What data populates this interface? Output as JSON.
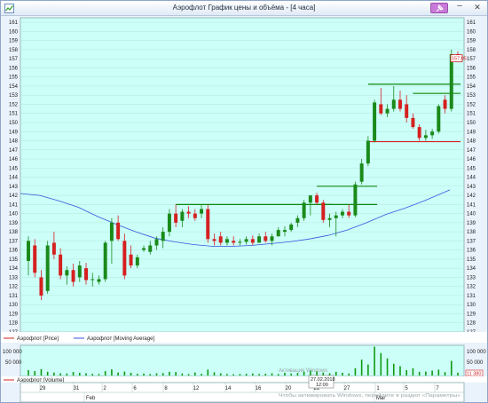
{
  "window": {
    "title": "Аэрофлот График цены и объёма - [4 часа]",
    "min_glyph": "–",
    "close_glyph": "✕"
  },
  "legend": {
    "price_label": "Аэрофлот [Price]",
    "ma_label": "Аэрофлот [Moving Average]",
    "volume_label": "Аэрофлот [Volume]"
  },
  "colors": {
    "chart_bg": "#ccfff8",
    "up": "#1a8a1a",
    "down": "#d62020",
    "ma_line": "#3355dd",
    "level_green": "#118811",
    "level_red": "#dd2222",
    "volume_bar": "#119911"
  },
  "price_axis": {
    "ticks": [
      "127",
      "128",
      "129",
      "130",
      "131",
      "132",
      "133",
      "134",
      "135",
      "136",
      "137",
      "138",
      "139",
      "140",
      "141",
      "142",
      "143",
      "144",
      "145",
      "146",
      "147",
      "148",
      "149",
      "150",
      "151",
      "152",
      "153",
      "154",
      "155",
      "156",
      "157",
      "158",
      "159",
      "160",
      "161"
    ],
    "last_price": "157.05"
  },
  "volume_axis": {
    "ticks": [
      "100 000",
      "50 000"
    ],
    "last_volume": "11 380"
  },
  "time_axis": {
    "day_labels": [
      "29",
      "31",
      "2",
      "6",
      "8",
      "12",
      "14",
      "16",
      "20",
      "22",
      "27",
      "1",
      "5",
      "7"
    ],
    "month_labels": [
      "Feb",
      "Mar"
    ],
    "cursor_date": "27.02.2018",
    "cursor_time": "12:00"
  },
  "watermark": {
    "line1": "Активация Windows",
    "line2": "Чтобы активировать Windows, перейдите в раздел «Параметры»"
  },
  "chart_data": {
    "type": "candlestick",
    "timeframe": "4 часа",
    "ylim": [
      127,
      161.5
    ],
    "candles": [
      {
        "o": 134.8,
        "h": 137.5,
        "l": 133.2,
        "c": 137.0
      },
      {
        "o": 136.5,
        "h": 137.2,
        "l": 133.0,
        "c": 133.5
      },
      {
        "o": 133.0,
        "h": 133.8,
        "l": 130.5,
        "c": 131.0
      },
      {
        "o": 131.5,
        "h": 137.0,
        "l": 131.2,
        "c": 136.5
      },
      {
        "o": 136.8,
        "h": 138.0,
        "l": 135.0,
        "c": 135.5
      },
      {
        "o": 135.5,
        "h": 136.2,
        "l": 132.8,
        "c": 133.2
      },
      {
        "o": 133.2,
        "h": 134.2,
        "l": 132.2,
        "c": 133.8
      },
      {
        "o": 133.8,
        "h": 134.5,
        "l": 132.0,
        "c": 132.5
      },
      {
        "o": 133.0,
        "h": 134.8,
        "l": 132.5,
        "c": 134.3
      },
      {
        "o": 134.0,
        "h": 134.6,
        "l": 132.2,
        "c": 132.7
      },
      {
        "o": 132.7,
        "h": 133.5,
        "l": 132.0,
        "c": 132.8
      },
      {
        "o": 132.5,
        "h": 133.2,
        "l": 132.2,
        "c": 132.8
      },
      {
        "o": 132.8,
        "h": 137.0,
        "l": 132.5,
        "c": 136.8
      },
      {
        "o": 137.0,
        "h": 139.5,
        "l": 134.5,
        "c": 139.0
      },
      {
        "o": 139.0,
        "h": 139.8,
        "l": 137.0,
        "c": 137.2
      },
      {
        "o": 137.0,
        "h": 137.8,
        "l": 132.8,
        "c": 133.2
      },
      {
        "o": 135.5,
        "h": 136.5,
        "l": 134.0,
        "c": 134.3
      },
      {
        "o": 134.3,
        "h": 135.5,
        "l": 134.0,
        "c": 135.2
      },
      {
        "o": 136.0,
        "h": 136.5,
        "l": 135.8,
        "c": 136.2
      },
      {
        "o": 135.8,
        "h": 137.0,
        "l": 135.5,
        "c": 136.5
      },
      {
        "o": 136.5,
        "h": 137.5,
        "l": 136.0,
        "c": 137.2
      },
      {
        "o": 137.0,
        "h": 138.5,
        "l": 136.2,
        "c": 138.0
      },
      {
        "o": 138.0,
        "h": 140.5,
        "l": 137.5,
        "c": 140.0
      },
      {
        "o": 140.0,
        "h": 141.0,
        "l": 138.5,
        "c": 139.0
      },
      {
        "o": 139.2,
        "h": 140.5,
        "l": 138.5,
        "c": 140.2
      },
      {
        "o": 140.2,
        "h": 140.8,
        "l": 139.5,
        "c": 140.0
      },
      {
        "o": 140.0,
        "h": 140.5,
        "l": 139.2,
        "c": 139.5
      },
      {
        "o": 140.0,
        "h": 141.0,
        "l": 139.5,
        "c": 140.5
      },
      {
        "o": 140.5,
        "h": 141.0,
        "l": 136.8,
        "c": 137.2
      },
      {
        "o": 137.2,
        "h": 137.8,
        "l": 136.5,
        "c": 137.0
      },
      {
        "o": 137.5,
        "h": 138.0,
        "l": 136.5,
        "c": 136.8
      },
      {
        "o": 136.8,
        "h": 137.5,
        "l": 136.5,
        "c": 137.2
      },
      {
        "o": 137.0,
        "h": 137.5,
        "l": 136.5,
        "c": 136.8
      },
      {
        "o": 136.8,
        "h": 137.2,
        "l": 136.5,
        "c": 136.9
      },
      {
        "o": 136.9,
        "h": 137.5,
        "l": 136.6,
        "c": 137.2
      },
      {
        "o": 137.2,
        "h": 137.6,
        "l": 136.5,
        "c": 136.8
      },
      {
        "o": 136.8,
        "h": 137.8,
        "l": 136.8,
        "c": 137.5
      },
      {
        "o": 137.5,
        "h": 138.0,
        "l": 136.8,
        "c": 137.0
      },
      {
        "o": 137.0,
        "h": 137.8,
        "l": 136.5,
        "c": 137.5
      },
      {
        "o": 137.5,
        "h": 138.5,
        "l": 137.5,
        "c": 138.2
      },
      {
        "o": 138.0,
        "h": 138.6,
        "l": 137.5,
        "c": 138.2
      },
      {
        "o": 138.2,
        "h": 139.0,
        "l": 138.0,
        "c": 138.8
      },
      {
        "o": 139.0,
        "h": 139.8,
        "l": 138.5,
        "c": 139.5
      },
      {
        "o": 139.5,
        "h": 141.5,
        "l": 139.2,
        "c": 141.2
      },
      {
        "o": 141.2,
        "h": 142.0,
        "l": 139.8,
        "c": 142.0
      },
      {
        "o": 142.0,
        "h": 142.3,
        "l": 141.0,
        "c": 141.2
      },
      {
        "o": 141.2,
        "h": 141.5,
        "l": 139.0,
        "c": 139.3
      },
      {
        "o": 139.3,
        "h": 140.0,
        "l": 138.5,
        "c": 139.5
      },
      {
        "o": 139.5,
        "h": 140.2,
        "l": 137.5,
        "c": 139.8
      },
      {
        "o": 139.8,
        "h": 140.5,
        "l": 139.5,
        "c": 140.2
      },
      {
        "o": 140.2,
        "h": 141.0,
        "l": 139.5,
        "c": 139.8
      },
      {
        "o": 139.8,
        "h": 143.5,
        "l": 139.6,
        "c": 143.2
      },
      {
        "o": 143.5,
        "h": 146.0,
        "l": 143.2,
        "c": 145.5
      },
      {
        "o": 145.5,
        "h": 148.5,
        "l": 145.2,
        "c": 148.0
      },
      {
        "o": 148.0,
        "h": 152.5,
        "l": 147.8,
        "c": 152.2
      },
      {
        "o": 152.0,
        "h": 153.8,
        "l": 150.8,
        "c": 151.0
      },
      {
        "o": 151.0,
        "h": 152.0,
        "l": 150.6,
        "c": 151.5
      },
      {
        "o": 151.5,
        "h": 154.0,
        "l": 151.2,
        "c": 152.5
      },
      {
        "o": 152.5,
        "h": 153.5,
        "l": 151.2,
        "c": 151.5
      },
      {
        "o": 152.0,
        "h": 153.0,
        "l": 150.0,
        "c": 150.5
      },
      {
        "o": 150.5,
        "h": 151.0,
        "l": 149.3,
        "c": 149.5
      },
      {
        "o": 149.5,
        "h": 149.8,
        "l": 148.0,
        "c": 148.3
      },
      {
        "o": 148.3,
        "h": 149.2,
        "l": 148.0,
        "c": 148.6
      },
      {
        "o": 148.6,
        "h": 149.3,
        "l": 148.2,
        "c": 149.0
      },
      {
        "o": 149.0,
        "h": 152.0,
        "l": 148.8,
        "c": 151.8
      },
      {
        "o": 152.5,
        "h": 153.0,
        "l": 151.0,
        "c": 151.5
      },
      {
        "o": 151.5,
        "h": 158.0,
        "l": 151.2,
        "c": 157.5
      },
      {
        "o": 157.5,
        "h": 157.8,
        "l": 156.6,
        "c": 157.05
      }
    ],
    "moving_average": [
      [
        0,
        142.2
      ],
      [
        3,
        142.0
      ],
      [
        6,
        141.4
      ],
      [
        9,
        140.7
      ],
      [
        12,
        139.7
      ],
      [
        15,
        138.8
      ],
      [
        18,
        138.0
      ],
      [
        21,
        137.3
      ],
      [
        24,
        136.9
      ],
      [
        27,
        136.6
      ],
      [
        30,
        136.4
      ],
      [
        33,
        136.4
      ],
      [
        36,
        136.5
      ],
      [
        39,
        136.7
      ],
      [
        42,
        136.9
      ],
      [
        45,
        137.2
      ],
      [
        48,
        137.6
      ],
      [
        51,
        138.2
      ],
      [
        54,
        139.0
      ],
      [
        57,
        139.9
      ],
      [
        60,
        140.6
      ],
      [
        63,
        141.4
      ],
      [
        66,
        142.3
      ],
      [
        67,
        142.6
      ]
    ],
    "levels": [
      {
        "color": "green",
        "price": 141.0,
        "from": 23,
        "to": 47
      },
      {
        "color": "green",
        "price": 143.0,
        "from": 45,
        "to": 54
      },
      {
        "color": "green",
        "price": 141.0,
        "from": 45,
        "to": 54
      },
      {
        "color": "green",
        "price": 154.2,
        "from": 53,
        "to": 67
      },
      {
        "color": "green",
        "price": 153.2,
        "from": 60,
        "to": 67
      },
      {
        "color": "red",
        "price": 147.9,
        "from": 53,
        "to": 67
      }
    ],
    "volume": [
      22000,
      18000,
      26000,
      15000,
      12000,
      9000,
      8000,
      14000,
      11000,
      9000,
      7000,
      6000,
      18000,
      25000,
      12000,
      16000,
      11000,
      7000,
      8000,
      6000,
      9000,
      10000,
      15000,
      14000,
      8000,
      6000,
      12000,
      7000,
      24000,
      13000,
      9000,
      6000,
      5000,
      6000,
      7000,
      8000,
      6000,
      7000,
      9000,
      6000,
      11000,
      8000,
      10000,
      16000,
      21000,
      18000,
      12000,
      9000,
      15000,
      11000,
      8000,
      30000,
      65000,
      45000,
      118000,
      92000,
      70000,
      48000,
      38000,
      22000,
      30000,
      15000,
      16000,
      20000,
      24000,
      14000,
      60000,
      11380
    ],
    "volume_ylim": [
      0,
      120000
    ]
  }
}
